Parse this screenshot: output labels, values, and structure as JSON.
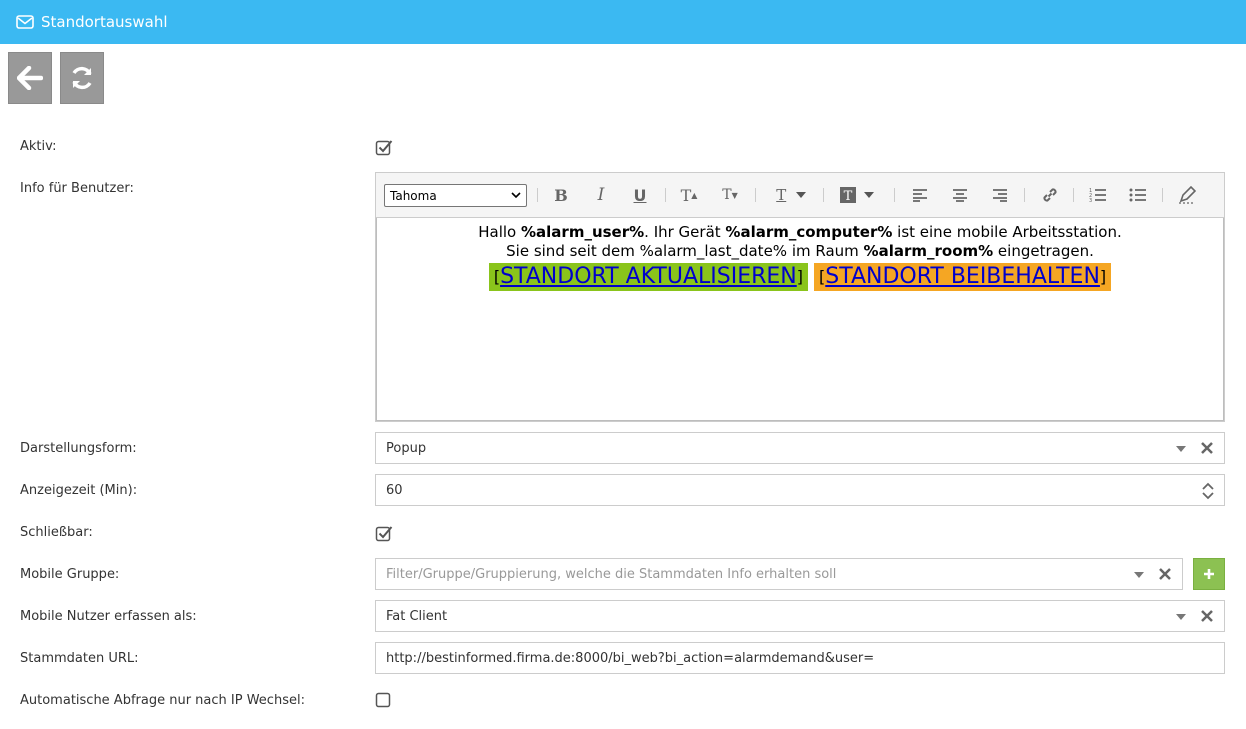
{
  "window": {
    "title": "Standortauswahl"
  },
  "toolbar": {
    "back_icon": "arrow-left-icon",
    "refresh_icon": "refresh-icon"
  },
  "form": {
    "aktiv": {
      "label": "Aktiv:",
      "checked": true
    },
    "info": {
      "label": "Info für Benutzer:",
      "font": "Tahoma",
      "line1_a": "Hallo ",
      "line1_b": "%alarm_user%",
      "line1_c": ". Ihr Gerät ",
      "line1_d": "%alarm_computer%",
      "line1_e": " ist eine mobile Arbeitsstation.",
      "line2_a": "Sie sind seit dem %alarm_last_date% im Raum ",
      "line2_b": "%alarm_room%",
      "line2_c": " eingetragen.",
      "bracket_open": "[",
      "bracket_close": "]",
      "btn_update": "STANDORT AKTUALISIEREN",
      "btn_keep": "STANDORT BEIBEHALTEN",
      "btn_update_color": "#8ac41b",
      "btn_keep_color": "#f5a623"
    },
    "darstellung": {
      "label": "Darstellungsform:",
      "value": "Popup"
    },
    "anzeigezeit": {
      "label": "Anzeigezeit (Min):",
      "value": "60"
    },
    "schliessbar": {
      "label": "Schließbar:",
      "checked": true
    },
    "mobile_gruppe": {
      "label": "Mobile Gruppe:",
      "placeholder": "Filter/Gruppe/Gruppierung, welche die Stammdaten Info erhalten soll"
    },
    "mobile_nutzer": {
      "label": "Mobile Nutzer erfassen als:",
      "value": "Fat Client"
    },
    "stammdaten_url": {
      "label": "Stammdaten URL:",
      "value": "http://bestinformed.firma.de:8000/bi_web?bi_action=alarmdemand&user="
    },
    "auto_abfrage": {
      "label": "Automatische Abfrage nur nach IP Wechsel:",
      "checked": false
    }
  },
  "colors": {
    "header": "#3bb9f2",
    "add_button": "#8cc152",
    "toolbar_button": "#999999"
  }
}
